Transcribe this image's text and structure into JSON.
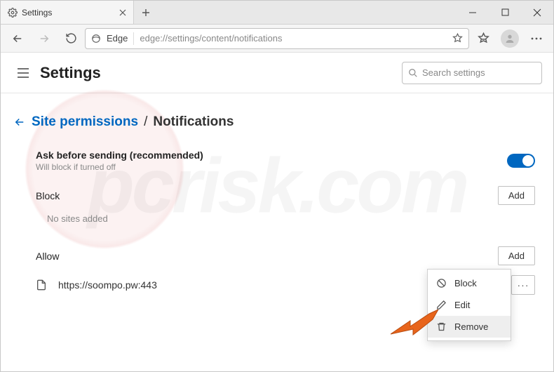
{
  "window": {
    "tab_title": "Settings",
    "url_scheme_label": "Edge",
    "url": "edge://settings/content/notifications"
  },
  "header": {
    "title": "Settings",
    "search_placeholder": "Search settings"
  },
  "breadcrumb": {
    "parent": "Site permissions",
    "separator": "/",
    "current": "Notifications"
  },
  "ask": {
    "label": "Ask before sending (recommended)",
    "sub": "Will block if turned off",
    "toggle": true
  },
  "block": {
    "title": "Block",
    "add_label": "Add",
    "empty": "No sites added"
  },
  "allow": {
    "title": "Allow",
    "add_label": "Add",
    "sites": [
      {
        "url": "https://soompo.pw:443"
      }
    ]
  },
  "context_menu": {
    "items": [
      {
        "icon": "block",
        "label": "Block"
      },
      {
        "icon": "edit",
        "label": "Edit"
      },
      {
        "icon": "remove",
        "label": "Remove"
      }
    ],
    "highlighted_index": 2
  }
}
